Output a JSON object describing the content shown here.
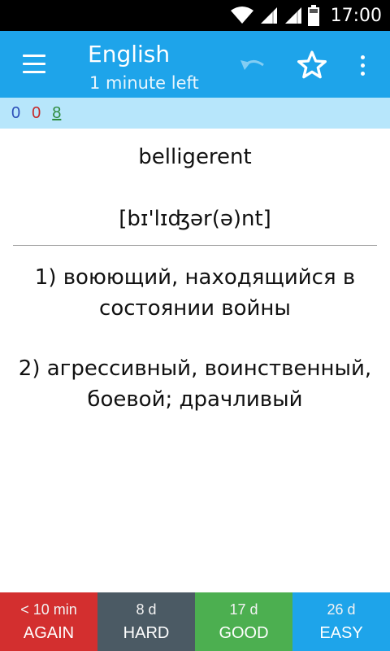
{
  "status_bar": {
    "time": "17:00",
    "icons": [
      "wifi-icon",
      "signal-icon",
      "signal-icon",
      "battery-icon"
    ]
  },
  "toolbar": {
    "title": "English",
    "subtitle": "1 minute left",
    "icons": [
      "menu-icon",
      "undo-icon",
      "star-icon",
      "more-vert-icon"
    ]
  },
  "counts": {
    "new": "0",
    "learning": "0",
    "review": "8"
  },
  "card": {
    "word": "belligerent",
    "pronunciation": "[bɪ'lɪʤər(ə)nt]",
    "definitions": [
      "1) воюющий, находящийся в состоянии войны",
      "2) агрессивный, воинственный, боевой; драчливый"
    ]
  },
  "answers": [
    {
      "interval": "< 10 min",
      "label": "AGAIN",
      "color": "#d32f2f"
    },
    {
      "interval": "8 d",
      "label": "HARD",
      "color": "#4b5a64"
    },
    {
      "interval": "17 d",
      "label": "GOOD",
      "color": "#4caf50"
    },
    {
      "interval": "26 d",
      "label": "EASY",
      "color": "#1ea4ea"
    }
  ],
  "colors": {
    "accent": "#1ea4ea",
    "counts_background": "#b7e6fb"
  }
}
